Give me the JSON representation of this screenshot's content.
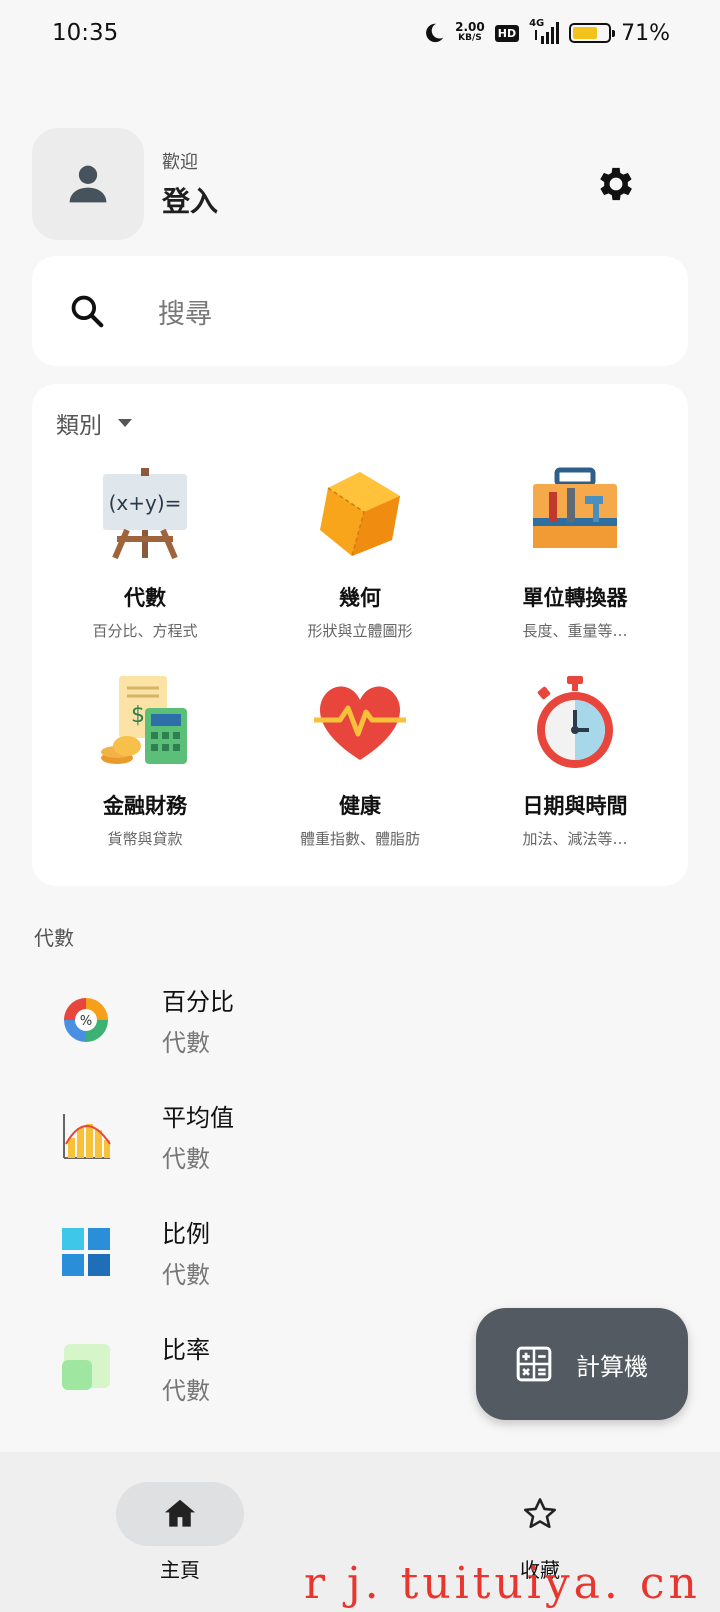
{
  "status_bar": {
    "time": "10:35",
    "net_speed_value": "2.00",
    "net_speed_unit": "KB/S",
    "hd": "HD",
    "network": "4G",
    "battery_percent": 71,
    "battery_label": "71%"
  },
  "profile": {
    "welcome": "歡迎",
    "login": "登入"
  },
  "search": {
    "placeholder": "搜尋"
  },
  "categories": {
    "title": "類別",
    "items": [
      {
        "title": "代數",
        "sub": "百分比、方程式",
        "icon": "algebra-easel-icon"
      },
      {
        "title": "幾何",
        "sub": "形狀與立體圖形",
        "icon": "geometry-cube-icon"
      },
      {
        "title": "單位轉換器",
        "sub": "長度、重量等…",
        "icon": "toolbox-icon"
      },
      {
        "title": "金融財務",
        "sub": "貨幣與貸款",
        "icon": "finance-calculator-icon"
      },
      {
        "title": "健康",
        "sub": "體重指數、體脂肪",
        "icon": "heart-pulse-icon"
      },
      {
        "title": "日期與時間",
        "sub": "加法、減法等…",
        "icon": "stopwatch-icon"
      }
    ]
  },
  "section": {
    "title": "代數"
  },
  "list": [
    {
      "title": "百分比",
      "sub": "代數",
      "icon": "percent-icon"
    },
    {
      "title": "平均值",
      "sub": "代數",
      "icon": "average-chart-icon"
    },
    {
      "title": "比例",
      "sub": "代數",
      "icon": "proportion-icon"
    },
    {
      "title": "比率",
      "sub": "代數",
      "icon": "ratio-icon"
    }
  ],
  "fab": {
    "label": "計算機"
  },
  "nav": {
    "home": "主頁",
    "favorites": "收藏"
  },
  "watermark": "r j. tuituiya. cn",
  "colors": {
    "fab": "#535a62",
    "accent_orange": "#f6a01a",
    "heart": "#e8453c",
    "battery": "#f4c21c"
  }
}
